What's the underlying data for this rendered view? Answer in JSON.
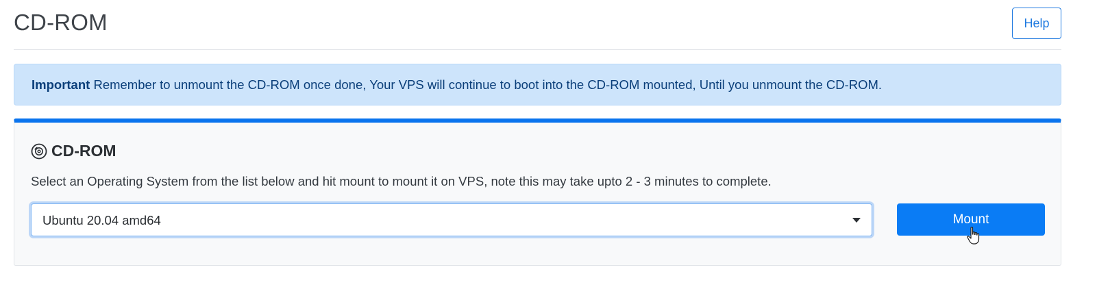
{
  "header": {
    "title": "CD-ROM",
    "help_label": "Help"
  },
  "alert": {
    "strong": "Important",
    "message": " Remember to unmount the CD-ROM once done, Your VPS will continue to boot into the CD-ROM mounted, Until you unmount the CD-ROM."
  },
  "panel": {
    "icon": "cd-disc-icon",
    "title": "CD-ROM",
    "description": "Select an Operating System from the list below and hit mount to mount it on VPS, note this may take upto 2 - 3 minutes to complete.",
    "os_select": {
      "selected": "Ubuntu 20.04 amd64"
    },
    "mount_label": "Mount"
  },
  "colors": {
    "accent": "#0a7cf5",
    "panel_top_border": "#0a74ee",
    "alert_background": "#cde4fb",
    "alert_text": "#0b3f7a"
  }
}
